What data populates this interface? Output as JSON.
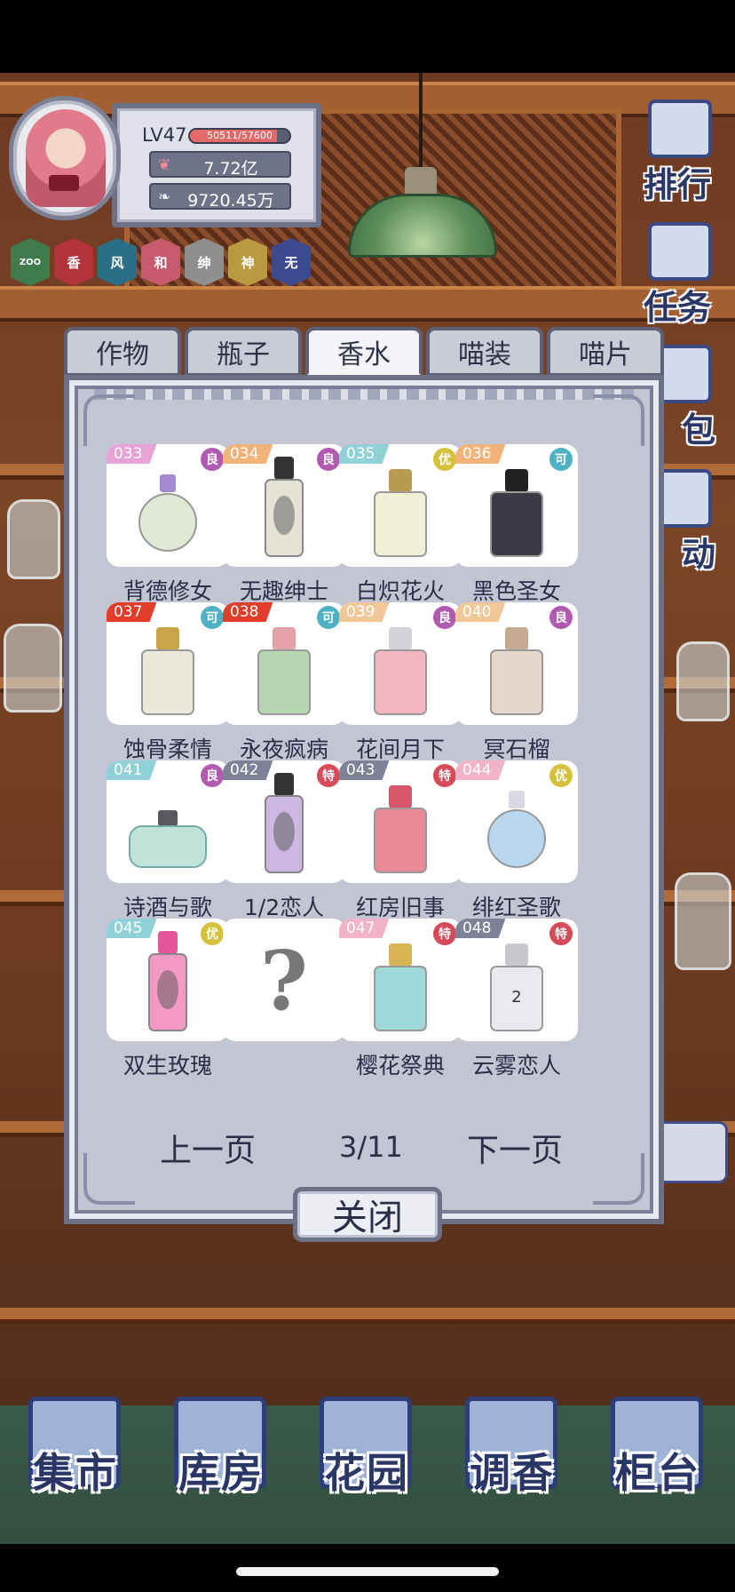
{
  "hud": {
    "level": "LV47",
    "xp_text": "50511/57600",
    "xp_fraction": 0.877,
    "currency_primary": "7.72亿",
    "currency_secondary": "9720.45万",
    "badges": [
      {
        "label": "ZOO",
        "color": "#3e7a4b"
      },
      {
        "label": "香",
        "color": "#b2333a"
      },
      {
        "label": "风",
        "color": "#2b6f86"
      },
      {
        "label": "和",
        "color": "#c55b6d"
      },
      {
        "label": "绅",
        "color": "#8f8f8f"
      },
      {
        "label": "神",
        "color": "#b99a3f"
      },
      {
        "label": "无",
        "color": "#3d4a8f"
      }
    ]
  },
  "side_buttons": [
    "排行",
    "任务",
    "包",
    "动"
  ],
  "tabs": [
    {
      "label": "作物",
      "active": false
    },
    {
      "label": "瓶子",
      "active": false
    },
    {
      "label": "香水",
      "active": true
    },
    {
      "label": "喵装",
      "active": false
    },
    {
      "label": "喵片",
      "active": false
    }
  ],
  "items": [
    {
      "num": "033",
      "num_color": "#e6a3d4",
      "grade": "良",
      "grade_color": "#b05ab0",
      "name": "背德修女",
      "icon": "round-lavender-perfume-icon"
    },
    {
      "num": "034",
      "num_color": "#f2b37a",
      "grade": "良",
      "grade_color": "#b05ab0",
      "name": "无趣绅士",
      "icon": "tall-black-cap-perfume-icon"
    },
    {
      "num": "035",
      "num_color": "#8fd1d6",
      "grade": "优",
      "grade_color": "#d6c13c",
      "name": "白炽花火",
      "icon": "square-gold-perfume-icon"
    },
    {
      "num": "036",
      "num_color": "#f2b37a",
      "grade": "可",
      "grade_color": "#4fb1c4",
      "name": "黑色圣女",
      "icon": "black-square-perfume-icon"
    },
    {
      "num": "037",
      "num_color": "#e23c2a",
      "grade": "可",
      "grade_color": "#4fb1c4",
      "name": "蚀骨柔情",
      "icon": "gold-cap-perfume-icon"
    },
    {
      "num": "038",
      "num_color": "#e23c2a",
      "grade": "可",
      "grade_color": "#4fb1c4",
      "name": "永夜疯病",
      "icon": "green-pink-cap-perfume-icon"
    },
    {
      "num": "039",
      "num_color": "#f2c79a",
      "grade": "良",
      "grade_color": "#b05ab0",
      "name": "花间月下",
      "icon": "pink-rect-perfume-icon"
    },
    {
      "num": "040",
      "num_color": "#f2c79a",
      "grade": "良",
      "grade_color": "#b05ab0",
      "name": "冥石榴",
      "icon": "brown-perfume-icon"
    },
    {
      "num": "041",
      "num_color": "#8fd1d6",
      "grade": "良",
      "grade_color": "#b05ab0",
      "name": "诗酒与歌",
      "icon": "teal-glass-perfume-icon"
    },
    {
      "num": "042",
      "num_color": "#7f8296",
      "grade": "特",
      "grade_color": "#d64a5a",
      "name": "1/2恋人",
      "icon": "tall-purple-perfume-icon"
    },
    {
      "num": "043",
      "num_color": "#7f8296",
      "grade": "特",
      "grade_color": "#d64a5a",
      "name": "红房旧事",
      "icon": "red-bunny-perfume-icon"
    },
    {
      "num": "044",
      "num_color": "#f2b3c8",
      "grade": "优",
      "grade_color": "#d6c13c",
      "name": "绯红圣歌",
      "icon": "blue-round-perfume-icon"
    },
    {
      "num": "045",
      "num_color": "#8fd1d6",
      "grade": "优",
      "grade_color": "#d6c13c",
      "name": "双生玫瑰",
      "icon": "pink-slim-perfume-icon"
    },
    {
      "num": "",
      "num_color": "",
      "grade": "",
      "grade_color": "",
      "name": "",
      "icon": "question-mark-icon",
      "unknown": true,
      "unknown_glyph": "?"
    },
    {
      "num": "047",
      "num_color": "#f2b3c8",
      "grade": "特",
      "grade_color": "#d64a5a",
      "name": "樱花祭典",
      "icon": "teal-gold-cap-perfume-icon"
    },
    {
      "num": "048",
      "num_color": "#7f8296",
      "grade": "特",
      "grade_color": "#d64a5a",
      "name": "云雾恋人",
      "icon": "silver-2-perfume-icon",
      "bottle_text": "2"
    }
  ],
  "pager": {
    "prev": "上一页",
    "page": "3/11",
    "next": "下一页"
  },
  "close_label": "关闭",
  "bottom_nav": [
    "集市",
    "库房",
    "花园",
    "调香",
    "柜台"
  ]
}
